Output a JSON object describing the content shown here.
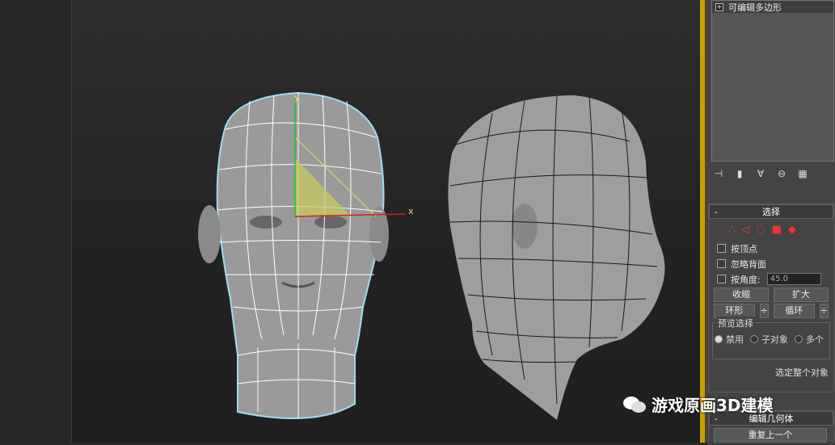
{
  "modifier_stack": {
    "item_label": "可编辑多边形"
  },
  "selection_rollout": {
    "title": "选择",
    "by_vertex_label": "按顶点",
    "ignore_backfacing_label": "忽略背面",
    "by_angle_label": "按角度:",
    "by_angle_value": "45.0",
    "shrink_label": "收缩",
    "grow_label": "扩大",
    "ring_label": "环形",
    "loop_label": "循环",
    "preview_group_label": "预览选择",
    "preview_options": [
      "禁用",
      "子对象",
      "多个"
    ],
    "preview_selected": "禁用",
    "select_whole_label": "选定整个对象"
  },
  "edit_geometry_rollout": {
    "title": "编辑几何体",
    "repeat_last_label": "重复上一个"
  },
  "viewport": {
    "axis_y_label": "y",
    "axis_x_label": "x"
  },
  "watermark": {
    "text": "游戏原画3D建模"
  },
  "colors": {
    "viewport_border": "#c8a000",
    "axis_x": "#d02020",
    "axis_y": "#20c020",
    "wire": "#ffffff",
    "gizmo_fill": "#c8c860"
  }
}
